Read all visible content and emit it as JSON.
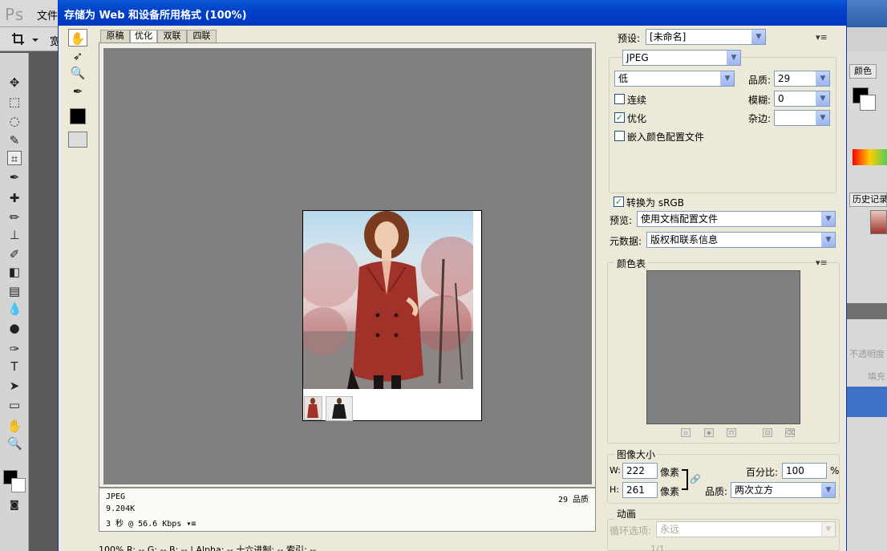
{
  "photoshop": {
    "logo": "Ps",
    "menu_file": "文件",
    "option_w": "宽",
    "color_panel_tab": "颜色",
    "history_panel_tab": "历史记录",
    "opacity_label": "不透明度",
    "fill_label": "填充"
  },
  "dialog": {
    "title": "存储为 Web 和设备所用格式 (100%)",
    "tabs": [
      {
        "label": "原稿",
        "active": false
      },
      {
        "label": "优化",
        "active": true
      },
      {
        "label": "双联",
        "active": false
      },
      {
        "label": "四联",
        "active": false
      }
    ],
    "info": {
      "format": "JPEG",
      "size": "9.204K",
      "time": "3 秒 @ 56.6 Kbps",
      "quality": "29 品质"
    },
    "bottom_bar": "100%   R:  --  G:  --  B:  --  |  Alpha: --  十六进制: --  索引: --"
  },
  "settings": {
    "preset_label": "预设:",
    "preset_value": "[未命名]",
    "format_value": "JPEG",
    "compression_value": "低",
    "quality_label": "品质:",
    "quality_value": "29",
    "progressive_label": "连续",
    "progressive_checked": false,
    "blur_label": "模糊:",
    "blur_value": "0",
    "optimized_label": "优化",
    "optimized_checked": true,
    "matte_label": "杂边:",
    "matte_value": "",
    "embed_profile_label": "嵌入颜色配置文件",
    "embed_profile_checked": false,
    "convert_srgb_label": "转换为 sRGB",
    "convert_srgb_checked": true,
    "preview_label": "预览:",
    "preview_value": "使用文档配置文件",
    "metadata_label": "元数据:",
    "metadata_value": "版权和联系信息",
    "color_table_title": "颜色表",
    "image_size_title": "图像大小",
    "width_label": "W:",
    "width_value": "222",
    "height_label": "H:",
    "height_value": "261",
    "pixel_unit": "像素",
    "percent_label": "百分比:",
    "percent_value": "100",
    "percent_unit": "%",
    "resample_label": "品质:",
    "resample_value": "两次立方",
    "animation_title": "动画",
    "loop_label": "循环选项:",
    "loop_value": "永远",
    "frame_counter": "1/1"
  },
  "colors": {
    "titlebar": "#0a5bd9",
    "dialog_bg": "#ece9d8",
    "canvas_gray": "#7f7f7f",
    "coat": "#a0322a"
  }
}
